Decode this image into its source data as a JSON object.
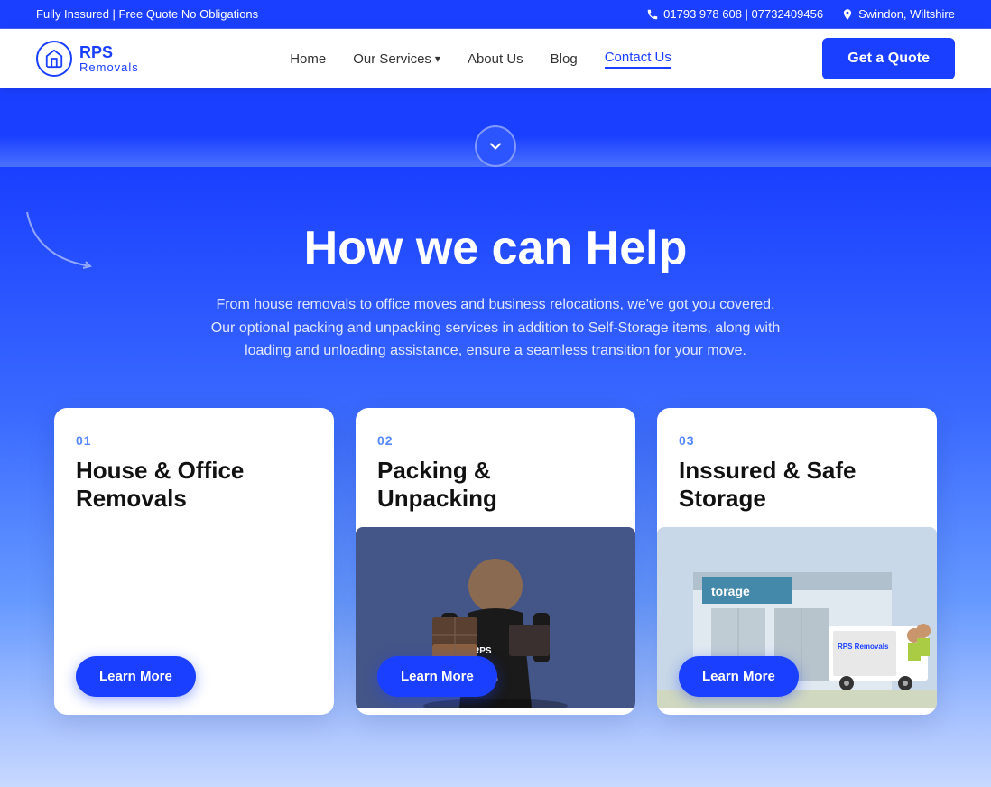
{
  "topbar": {
    "tagline": "Fully Inssured | Free Quote No Obligations",
    "phone": "01793 978 608 | 07732409456",
    "location": "Swindon, Wiltshire"
  },
  "navbar": {
    "logo": {
      "icon": "🏠",
      "brand1": "RPS",
      "brand2": "Removals"
    },
    "links": [
      {
        "label": "Home",
        "active": false
      },
      {
        "label": "Our Services",
        "active": false,
        "dropdown": true
      },
      {
        "label": "About Us",
        "active": false
      },
      {
        "label": "Blog",
        "active": false
      },
      {
        "label": "Contact Us",
        "active": true
      }
    ],
    "cta": "Get a Quote"
  },
  "scroll": {
    "icon": "∨"
  },
  "help": {
    "heading": "How we can Help",
    "description": "From house removals to office moves and business relocations, we've got you covered. Our optional packing and unpacking services in addition to Self-Storage items, along with loading and unloading assistance, ensure a seamless transition for your move.",
    "cards": [
      {
        "num": "01",
        "title": "House & Office Removals",
        "learn_more": "Learn More"
      },
      {
        "num": "02",
        "title": "Packing & Unpacking",
        "learn_more": "Learn More"
      },
      {
        "num": "03",
        "title": "Inssured & Safe Storage",
        "learn_more": "Learn More"
      }
    ]
  }
}
